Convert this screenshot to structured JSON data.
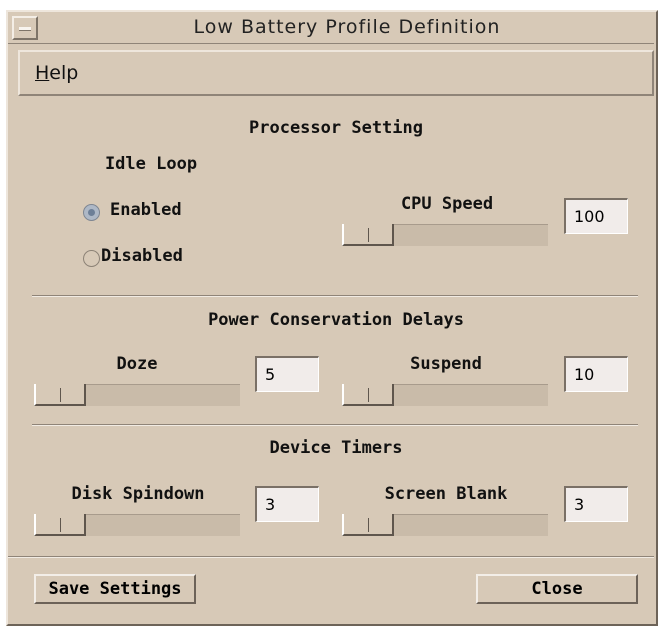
{
  "window": {
    "title": "Low Battery Profile Definition"
  },
  "menu": {
    "help_label": "Help",
    "help_mnemonic": "H"
  },
  "processor": {
    "heading": "Processor Setting",
    "idle_loop_label": "Idle Loop",
    "enabled_label": "Enabled",
    "disabled_label": "Disabled",
    "idle_loop_selected": "Enabled",
    "cpu_speed_label": "CPU Speed",
    "cpu_speed_value": "100"
  },
  "power": {
    "heading": "Power Conservation Delays",
    "doze_label": "Doze",
    "doze_value": "5",
    "suspend_label": "Suspend",
    "suspend_value": "10"
  },
  "timers": {
    "heading": "Device Timers",
    "disk_label": "Disk Spindown",
    "disk_value": "3",
    "screen_label": "Screen Blank",
    "screen_value": "3"
  },
  "buttons": {
    "save": "Save Settings",
    "close": "Close"
  },
  "icons": {
    "window_menu": "window-menu-icon"
  }
}
